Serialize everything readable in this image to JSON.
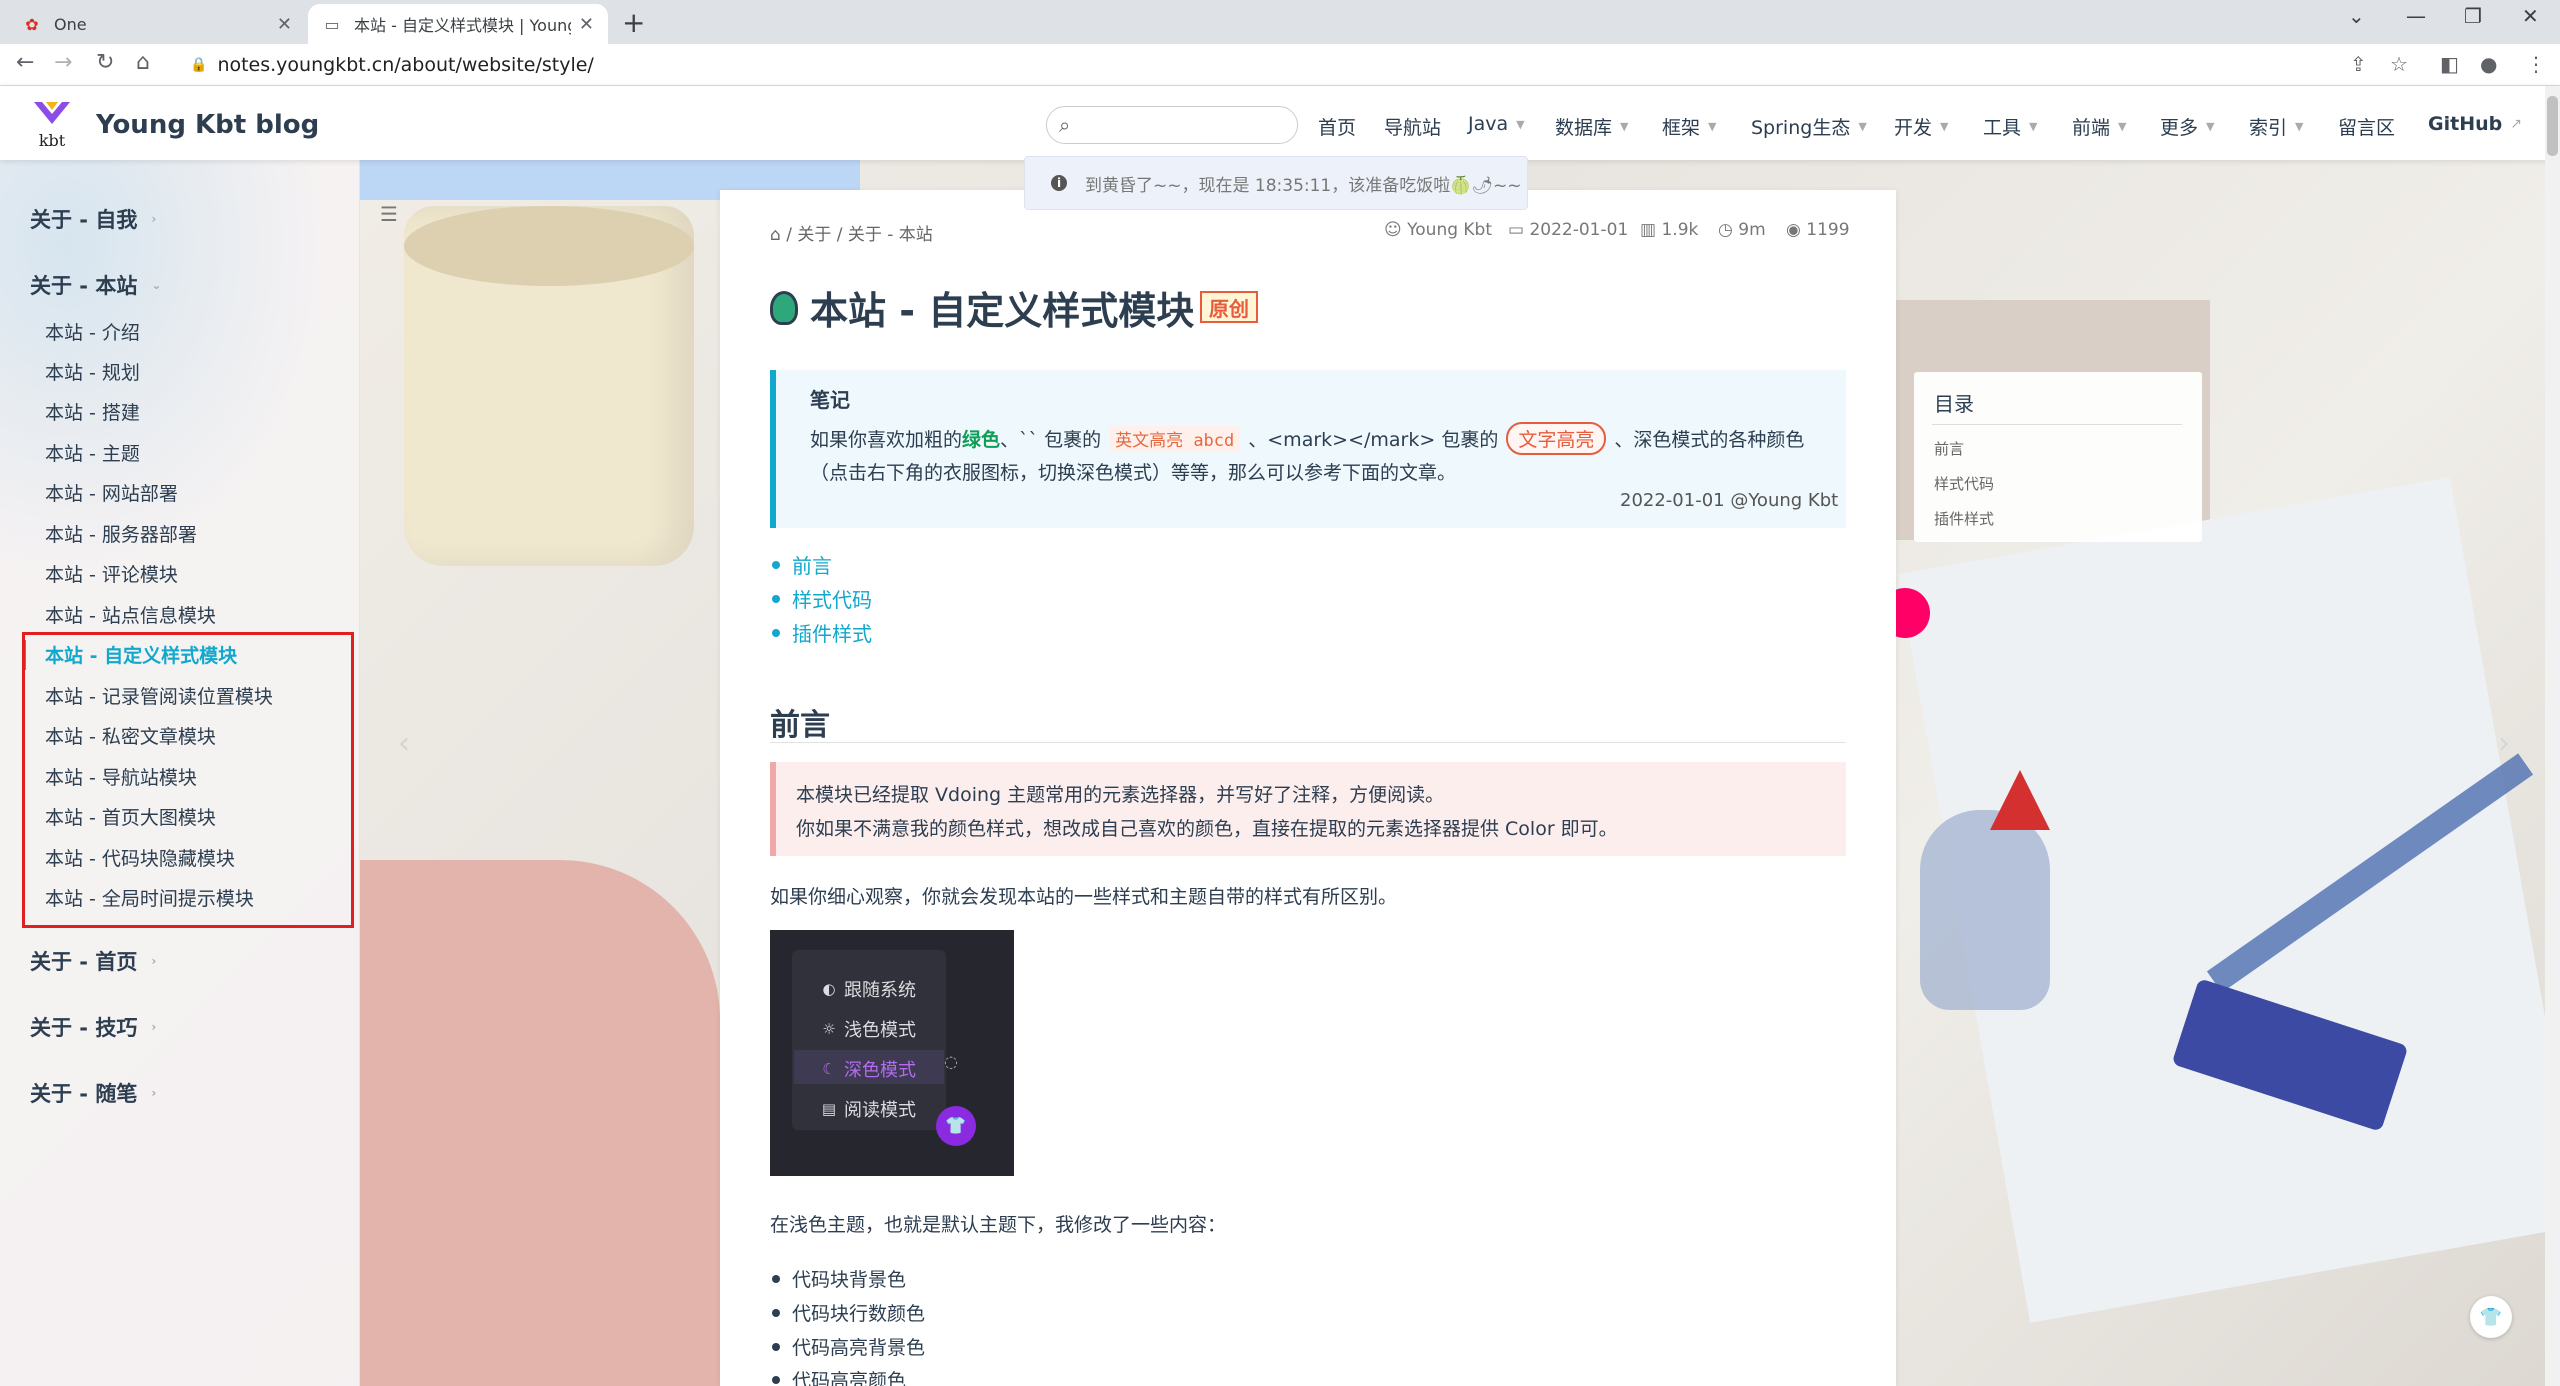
{
  "browser": {
    "tabs": [
      {
        "title": "One",
        "icon": "red-flower-icon"
      },
      {
        "title": "本站 - 自定义样式模块 | Young Kbt blog",
        "icon": "page-icon"
      }
    ],
    "url": "notes.youngkbt.cn/about/website/style/"
  },
  "site": {
    "logo_text": "kbt",
    "name": "Young Kbt blog",
    "nav": [
      "首页",
      "导航站",
      "Java",
      "数据库",
      "框架",
      "Spring生态",
      "开发",
      "工具",
      "前端",
      "更多",
      "索引",
      "留言区",
      "GitHub"
    ]
  },
  "toast": {
    "text": "到黄昏了~~，现在是 18:35:11，该准备吃饭啦🍈🌶~~"
  },
  "sidebar": {
    "groups": [
      "关于 - 自我",
      "关于 - 本站",
      "关于 - 首页",
      "关于 - 技巧",
      "关于 - 随笔"
    ],
    "items": [
      "本站 - 介绍",
      "本站 - 规划",
      "本站 - 搭建",
      "本站 - 主题",
      "本站 - 网站部署",
      "本站 - 服务器部署",
      "本站 - 评论模块",
      "本站 - 站点信息模块",
      "本站 - 自定义样式模块",
      "本站 - 记录管阅读位置模块",
      "本站 - 私密文章模块",
      "本站 - 导航站模块",
      "本站 - 首页大图模块",
      "本站 - 代码块隐藏模块",
      "本站 - 全局时间提示模块"
    ]
  },
  "article": {
    "breadcrumb": "/ 关于 / 关于 - 本站",
    "author": "Young Kbt",
    "date": "2022-01-01",
    "words": "1.9k",
    "read_time": "9m",
    "views": "1199",
    "title": "本站 - 自定义样式模块",
    "badge": "原创",
    "note": {
      "title": "笔记",
      "l1_a": "如果你喜欢加粗的",
      "l1_green": "绿色",
      "l1_b": "、`` 包裹的",
      "l1_code": "英文高亮 abcd",
      "l1_c": "、<mark></mark> 包裹的",
      "l1_pill": "文字高亮",
      "l1_d": "、深色模式的各种颜色",
      "l2": "（点击右下角的衣服图标，切换深色模式）等等，那么可以参考下面的文章。",
      "sign": "2022-01-01 @Young Kbt"
    },
    "toc": [
      "前言",
      "样式代码",
      "插件样式"
    ],
    "h2": "前言",
    "warn_l1": "本模块已经提取 Vdoing 主题常用的元素选择器，并写好了注释，方便阅读。",
    "warn_l2": "你如果不满意我的颜色样式，想改成自己喜欢的颜色，直接在提取的元素选择器提供 Color 即可。",
    "para1": "如果你细心观察，你就会发现本站的一些样式和主题自带的样式有所区别。",
    "demo_menu": [
      "跟随系统",
      "浅色模式",
      "深色模式",
      "阅读模式"
    ],
    "para2": "在浅色主题，也就是默认主题下，我修改了一些内容：",
    "list": [
      "代码块背景色",
      "代码块行数颜色",
      "代码高亮背景色",
      "代码高亮颜色"
    ]
  },
  "toc_panel": {
    "title": "目录",
    "items": [
      "前言",
      "样式代码",
      "插件样式"
    ]
  }
}
